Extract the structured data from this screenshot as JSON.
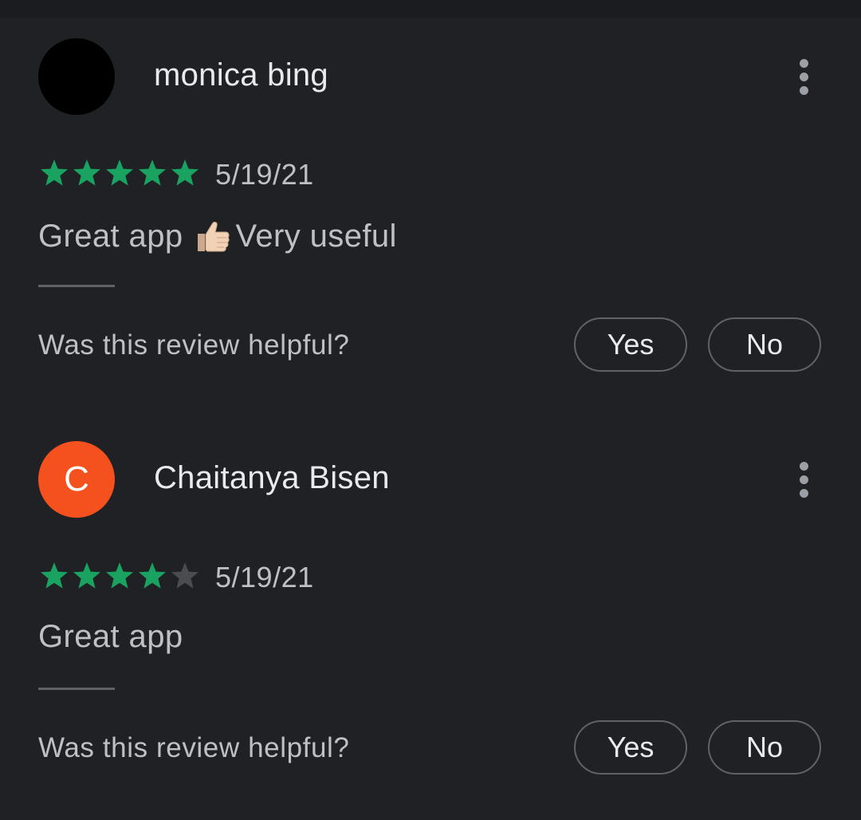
{
  "colors": {
    "background": "#202124",
    "star_filled": "#1aa261",
    "star_empty": "#4a4c50",
    "avatar_orange": "#f4511e",
    "avatar_black": "#000000"
  },
  "reviews": [
    {
      "author": "monica bing",
      "avatar_letter": "",
      "avatar_color": "#000000",
      "rating": 5,
      "max_rating": 5,
      "date": "5/19/21",
      "text_before_emoji": "Great app",
      "emoji": "thumbs-up",
      "text_after_emoji": "Very useful",
      "helpful_question": "Was this review helpful?",
      "yes_label": "Yes",
      "no_label": "No"
    },
    {
      "author": "Chaitanya Bisen",
      "avatar_letter": "C",
      "avatar_color": "#f4511e",
      "rating": 4,
      "max_rating": 5,
      "date": "5/19/21",
      "text_before_emoji": "Great app",
      "emoji": "",
      "text_after_emoji": "",
      "helpful_question": "Was this review helpful?",
      "yes_label": "Yes",
      "no_label": "No"
    }
  ]
}
